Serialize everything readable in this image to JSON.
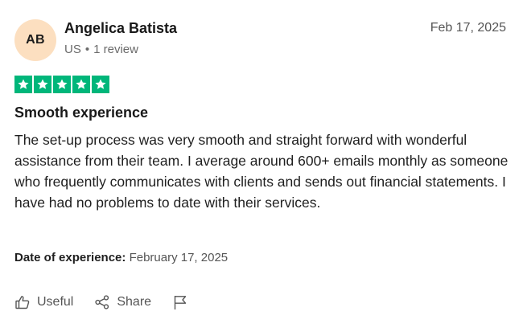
{
  "reviewer": {
    "initials": "AB",
    "avatar_color": "#FCDFC0",
    "name": "Angelica Batista",
    "country": "US",
    "separator": "•",
    "review_count": "1 review"
  },
  "review": {
    "date": "Feb 17, 2025",
    "rating": 5,
    "rating_max": 5,
    "star_color": "#00B67A",
    "title": "Smooth experience",
    "body": "The set-up process was very smooth and straight forward with wonderful assistance from their team. I average around 600+ emails monthly as someone who frequently communicates with clients and sends out financial statements. I have had no problems to date with their services.",
    "experience_label": "Date of experience:",
    "experience_date": "February 17, 2025"
  },
  "actions": {
    "useful_label": "Useful",
    "useful_icon": "thumbs-up-icon",
    "share_label": "Share",
    "share_icon": "share-icon",
    "report_icon": "flag-icon"
  }
}
